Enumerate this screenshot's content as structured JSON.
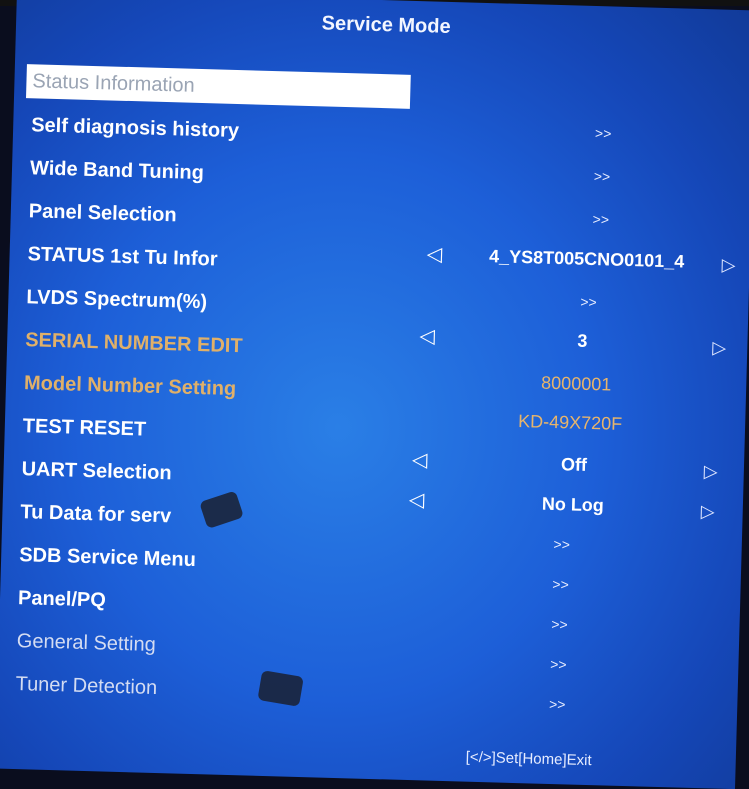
{
  "title": "Service Mode",
  "menu": [
    {
      "label": "Status Information",
      "value": "",
      "arrows": false,
      "style": "highlight"
    },
    {
      "label": "Self diagnosis history",
      "value": ">>",
      "arrows": false,
      "style": "normal"
    },
    {
      "label": "Wide Band Tuning",
      "value": ">>",
      "arrows": false,
      "style": "normal"
    },
    {
      "label": "Panel Selection",
      "value": ">>",
      "arrows": false,
      "style": "normal"
    },
    {
      "label": "STATUS 1st Tu Infor",
      "value": "4_YS8T005CNO0101_4",
      "arrows": true,
      "style": "normal"
    },
    {
      "label": "LVDS Spectrum(%)",
      "value": ">>",
      "arrows": false,
      "style": "normal"
    },
    {
      "label": "SERIAL NUMBER EDIT",
      "value": "3",
      "arrows": true,
      "style": "orange"
    },
    {
      "label": "Model Number Setting",
      "value": "8000001",
      "arrows": false,
      "style": "orange"
    },
    {
      "label": "TEST RESET",
      "value": "KD-49X720F",
      "arrows": false,
      "style": "normal"
    },
    {
      "label": "UART Selection",
      "value": "Off",
      "arrows": true,
      "style": "normal"
    },
    {
      "label": "Tu Data for serv",
      "value": "No Log",
      "arrows": true,
      "style": "normal"
    },
    {
      "label": "SDB Service Menu",
      "value": ">>",
      "arrows": false,
      "style": "normal"
    },
    {
      "label": "Panel/PQ",
      "value": ">>",
      "arrows": false,
      "style": "normal"
    },
    {
      "label": "General Setting",
      "value": ">>",
      "arrows": false,
      "style": "faded"
    },
    {
      "label": "Tuner Detection",
      "value": ">>",
      "arrows": false,
      "style": "faded"
    },
    {
      "label": "",
      "value": ">>",
      "arrows": false,
      "style": "none"
    }
  ],
  "arrow_left": "◁",
  "arrow_right": "▷",
  "footer": "[</>]Set[Home]Exit",
  "colors": {
    "background": "#1d5fd8",
    "highlight": "#ffffff",
    "orange_text": "#e0b069"
  }
}
